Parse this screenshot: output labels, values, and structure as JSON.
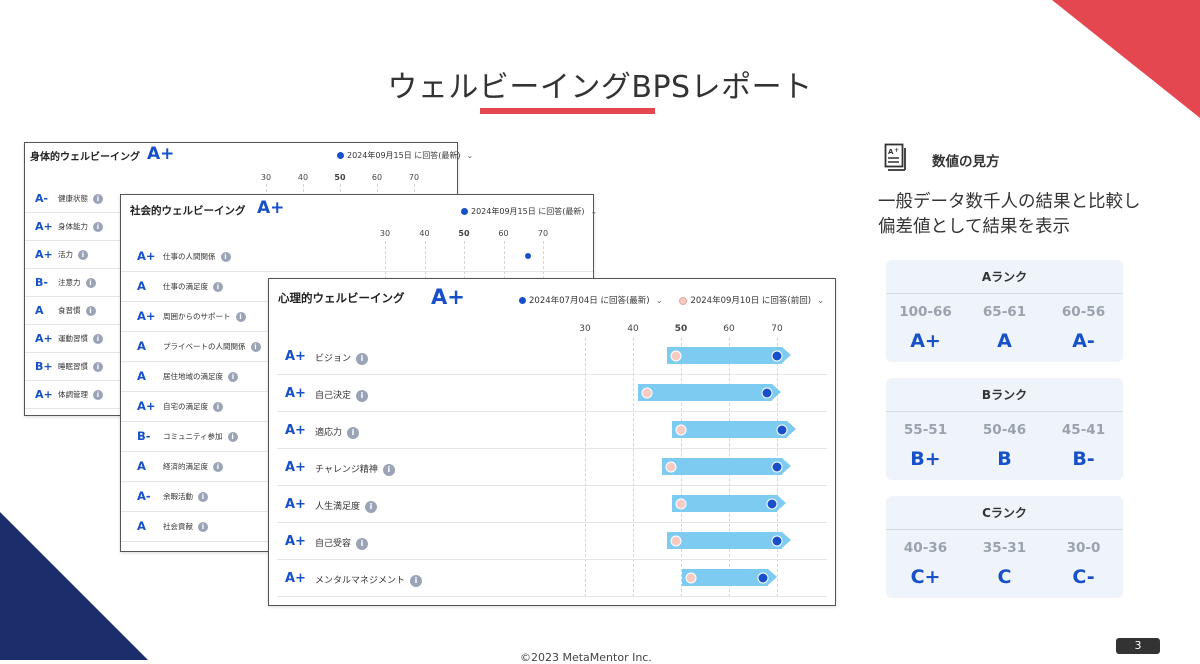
{
  "title": "ウェルビーイングBPSレポート",
  "page_number": "3",
  "copyright": "©2023 MetaMentor Inc.",
  "info_glyph": "i",
  "chevron": "⌄",
  "physical": {
    "title": "身体的ウェルビーイング",
    "overall": "A+",
    "legend_current": "2024年09月15日 に回答(最新)",
    "axis": [
      "30",
      "40",
      "50",
      "60",
      "70"
    ],
    "rows": [
      {
        "grade": "A-",
        "label": "健康状態"
      },
      {
        "grade": "A+",
        "label": "身体能力"
      },
      {
        "grade": "A+",
        "label": "活力"
      },
      {
        "grade": "B-",
        "label": "注意力"
      },
      {
        "grade": "A",
        "label": "食習慣"
      },
      {
        "grade": "A+",
        "label": "運動習慣"
      },
      {
        "grade": "B+",
        "label": "睡眠習慣"
      },
      {
        "grade": "A+",
        "label": "体調管理"
      }
    ]
  },
  "social": {
    "title": "社会的ウェルビーイング",
    "overall": "A+",
    "legend_current": "2024年09月15日 に回答(最新)",
    "axis": [
      "30",
      "40",
      "50",
      "60",
      "70"
    ],
    "rows": [
      {
        "grade": "A+",
        "label": "仕事の人間関係"
      },
      {
        "grade": "A",
        "label": "仕事の満足度"
      },
      {
        "grade": "A+",
        "label": "周囲からのサポート"
      },
      {
        "grade": "A",
        "label": "プライベートの人間関係"
      },
      {
        "grade": "A",
        "label": "居住地域の満足度"
      },
      {
        "grade": "A+",
        "label": "自宅の満足度"
      },
      {
        "grade": "B-",
        "label": "コミュニティ参加"
      },
      {
        "grade": "A",
        "label": "経済的満足度"
      },
      {
        "grade": "A-",
        "label": "余暇活動"
      },
      {
        "grade": "A",
        "label": "社会貢献"
      }
    ]
  },
  "psychological": {
    "title": "心理的ウェルビーイング",
    "overall": "A+",
    "legend_current": "2024年07月04日 に回答(最新)",
    "legend_previous": "2024年09月10日 に回答(前回)",
    "axis": [
      "30",
      "40",
      "50",
      "60",
      "70"
    ],
    "rows": [
      {
        "grade": "A+",
        "label": "ビジョン",
        "prev": 49,
        "cur": 70
      },
      {
        "grade": "A+",
        "label": "自己決定",
        "prev": 43,
        "cur": 68
      },
      {
        "grade": "A+",
        "label": "適応力",
        "prev": 50,
        "cur": 71
      },
      {
        "grade": "A+",
        "label": "チャレンジ精神",
        "prev": 48,
        "cur": 70
      },
      {
        "grade": "A+",
        "label": "人生満足度",
        "prev": 50,
        "cur": 69
      },
      {
        "grade": "A+",
        "label": "自己受容",
        "prev": 49,
        "cur": 70
      },
      {
        "grade": "A+",
        "label": "メンタルマネジメント",
        "prev": 52,
        "cur": 67
      }
    ]
  },
  "legend_panel": {
    "heading": "数値の見方",
    "desc_line1": "一般データ数千人の結果と比較し",
    "desc_line2": "偏差値として結果を表示",
    "ranks": [
      {
        "title": "Aランク",
        "items": [
          {
            "range": "100-66",
            "grade": "A+"
          },
          {
            "range": "65-61",
            "grade": "A"
          },
          {
            "range": "60-56",
            "grade": "A-"
          }
        ]
      },
      {
        "title": "Bランク",
        "items": [
          {
            "range": "55-51",
            "grade": "B+"
          },
          {
            "range": "50-46",
            "grade": "B"
          },
          {
            "range": "45-41",
            "grade": "B-"
          }
        ]
      },
      {
        "title": "Cランク",
        "items": [
          {
            "range": "40-36",
            "grade": "C+"
          },
          {
            "range": "35-31",
            "grade": "C"
          },
          {
            "range": "30-0",
            "grade": "C-"
          }
        ]
      }
    ]
  },
  "colors": {
    "accent_red": "#e4474f",
    "navy": "#1b2e6b",
    "grade_blue": "#1750c8",
    "bar_blue": "#7ecbf2",
    "prev_pink": "#f6cbc4"
  }
}
